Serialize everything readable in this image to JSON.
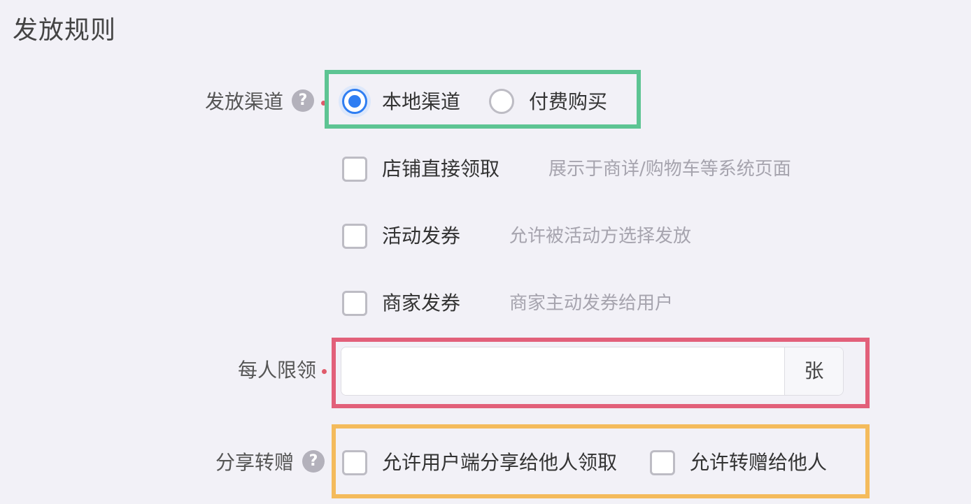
{
  "section": {
    "title": "发放规则"
  },
  "channel": {
    "label": "发放渠道",
    "help_icon": "?",
    "options": [
      {
        "label": "本地渠道",
        "selected": true
      },
      {
        "label": "付费购买",
        "selected": false
      }
    ],
    "sub_options": [
      {
        "label": "店铺直接领取",
        "hint": "展示于商详/购物车等系统页面",
        "checked": false
      },
      {
        "label": "活动发券",
        "hint": "允许被活动方选择发放",
        "checked": false
      },
      {
        "label": "商家发券",
        "hint": "商家主动发券给用户",
        "checked": false
      }
    ]
  },
  "limit": {
    "label": "每人限领",
    "value": "",
    "unit": "张"
  },
  "share": {
    "label": "分享转赠",
    "help_icon": "?",
    "options": [
      {
        "label": "允许用户端分享给他人领取",
        "checked": false
      },
      {
        "label": "允许转赠给他人",
        "checked": false
      }
    ]
  },
  "colors": {
    "accent": "#2f7ef2",
    "required": "#e05a6a",
    "frame_green": "#5dc493",
    "frame_red": "#e2607a",
    "frame_orange": "#f4bb5c"
  }
}
